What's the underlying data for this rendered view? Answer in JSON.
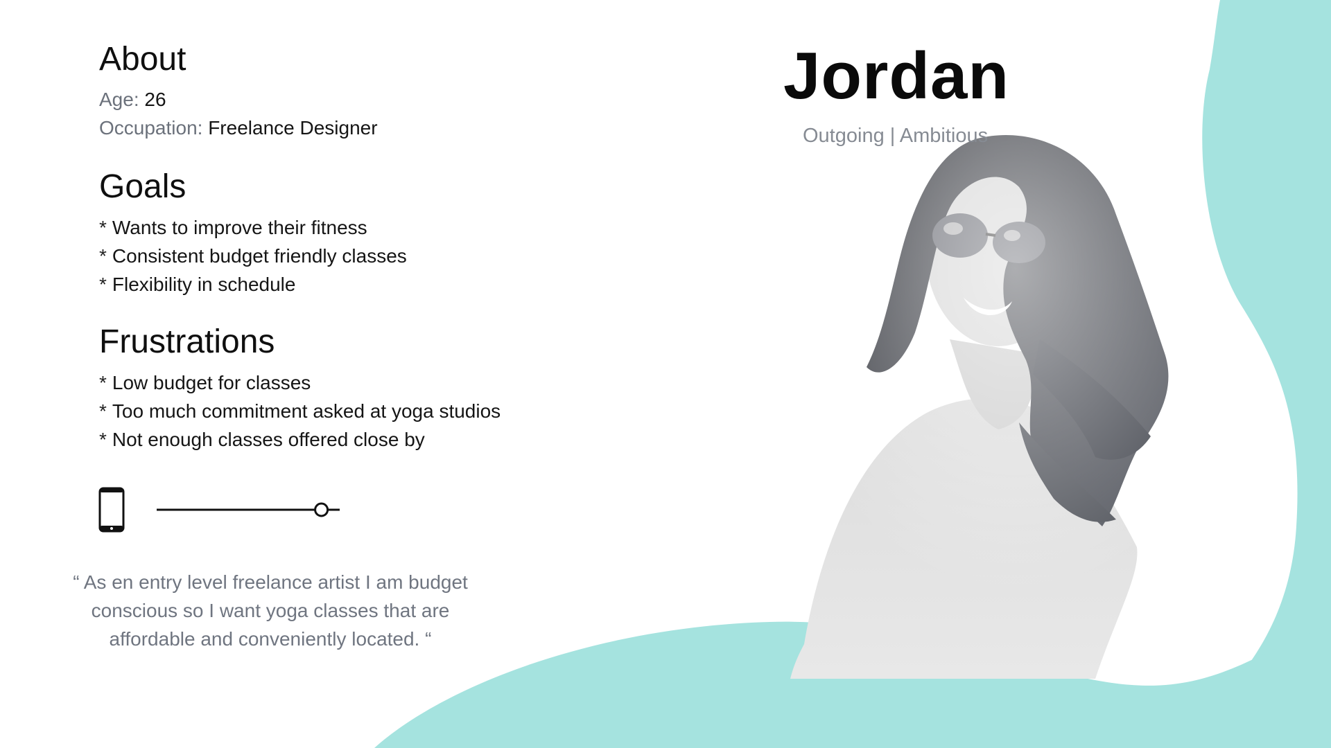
{
  "colors": {
    "accent": "#a5e3df",
    "heading": "#0f0f0f",
    "label_gray": "#6b717b",
    "quote_gray": "#6f7580"
  },
  "persona": {
    "name": "Jordan",
    "traits": "Outgoing | Ambitious"
  },
  "about": {
    "heading": "About",
    "age_label": "Age:",
    "age_value": "26",
    "occupation_label": "Occupation:",
    "occupation_value": "Freelance Designer"
  },
  "goals": {
    "heading": "Goals",
    "bullet": "*",
    "items": [
      "Wants to improve their fitness",
      "Consistent budget friendly classes",
      "Flexibility in schedule"
    ]
  },
  "frustrations": {
    "heading": "Frustrations",
    "bullet": "*",
    "items": [
      "Low budget for classes",
      "Too much commitment asked at yoga studios",
      "Not enough classes offered close by"
    ]
  },
  "device_usage": {
    "icon": "smartphone-icon",
    "level": 0.9
  },
  "quote": {
    "text": "“ As en entry level freelance artist I am budget conscious so I want yoga classes that are affordable and conveniently located. “"
  },
  "photo": {
    "icon": "persona-photo-grayscale"
  }
}
